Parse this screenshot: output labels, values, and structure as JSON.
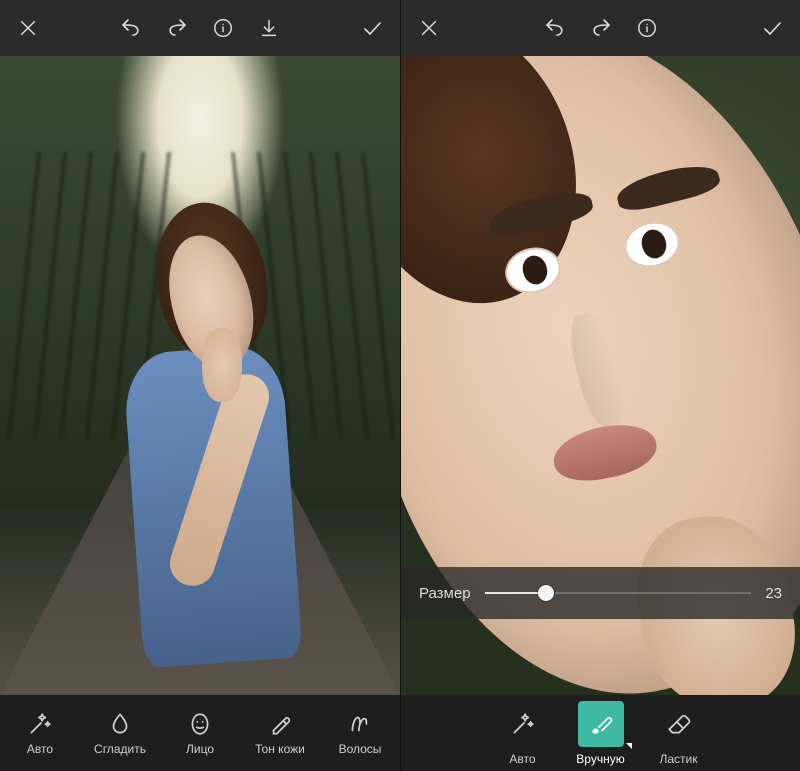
{
  "left": {
    "toolbar_top": {
      "close": "close-icon",
      "undo": "undo-icon",
      "redo": "redo-icon",
      "info": "info-icon",
      "download": "download-icon",
      "accept": "check-icon"
    },
    "tools": [
      {
        "id": "auto",
        "icon": "magic-wand-icon",
        "label": "Авто"
      },
      {
        "id": "smooth",
        "icon": "drop-icon",
        "label": "Сгладить"
      },
      {
        "id": "face",
        "icon": "face-icon",
        "label": "Лицо"
      },
      {
        "id": "skin",
        "icon": "skin-tone-icon",
        "label": "Тон кожи"
      },
      {
        "id": "hair",
        "icon": "hair-icon",
        "label": "Волосы"
      }
    ]
  },
  "right": {
    "toolbar_top": {
      "close": "close-icon",
      "undo": "undo-icon",
      "redo": "redo-icon",
      "info": "info-icon",
      "accept": "check-icon"
    },
    "slider": {
      "label": "Размер",
      "value": 23,
      "min": 0,
      "max": 100
    },
    "tools": [
      {
        "id": "auto",
        "icon": "magic-wand-icon",
        "label": "Авто",
        "active": false
      },
      {
        "id": "manual",
        "icon": "brush-icon",
        "label": "Вручную",
        "active": true
      },
      {
        "id": "eraser",
        "icon": "eraser-icon",
        "label": "Ластик",
        "active": false
      }
    ],
    "accent": "#3fb8a4"
  }
}
